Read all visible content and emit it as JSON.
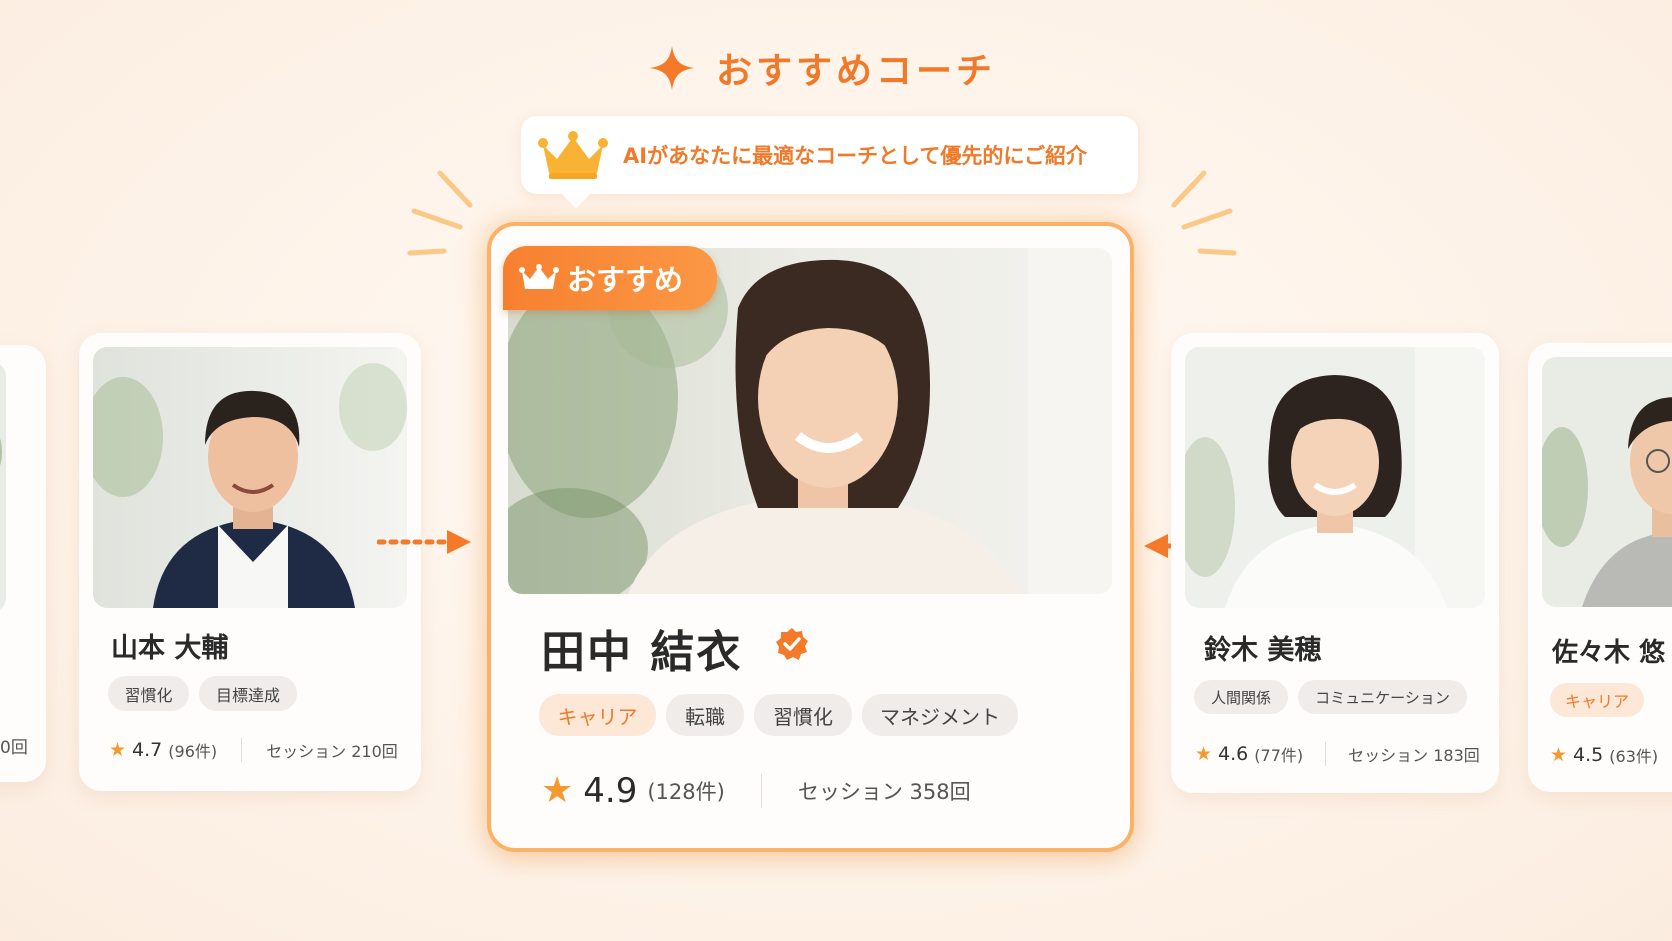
{
  "header": {
    "title": "おすすめコーチ"
  },
  "callout": {
    "text": "AIがあなたに最適なコーチとして優先的にご紹介"
  },
  "featured": {
    "badge": "おすすめ",
    "name": "田中 結衣",
    "tags": [
      "キャリア",
      "転職",
      "習慣化",
      "マネジメント"
    ],
    "rating": "4.9",
    "reviews": "(128件)",
    "sessions": "セッション 358回"
  },
  "coaches": [
    {
      "name": "山本 大輔",
      "tags": [
        "習慣化",
        "目標達成"
      ],
      "rating": "4.7",
      "reviews": "(96件)",
      "sessions": "セッション 210回"
    },
    {
      "name": "鈴木 美穂",
      "tags": [
        "人間関係",
        "コミュニケーション"
      ],
      "rating": "4.6",
      "reviews": "(77件)",
      "sessions": "セッション 183回"
    },
    {
      "name": "佐々木 悠",
      "tags": [
        "キャリア"
      ],
      "rating": "4.5",
      "reviews": "(63件)"
    }
  ],
  "partial_left": {
    "sessions_tail": "0回"
  },
  "colors": {
    "accent": "#f07a2a",
    "star": "#f59a2e",
    "border": "#fbb267"
  },
  "icons": [
    "sparkle-icon",
    "crown-icon",
    "verified-icon",
    "star-icon",
    "arrow-right-icon",
    "arrow-left-icon"
  ]
}
